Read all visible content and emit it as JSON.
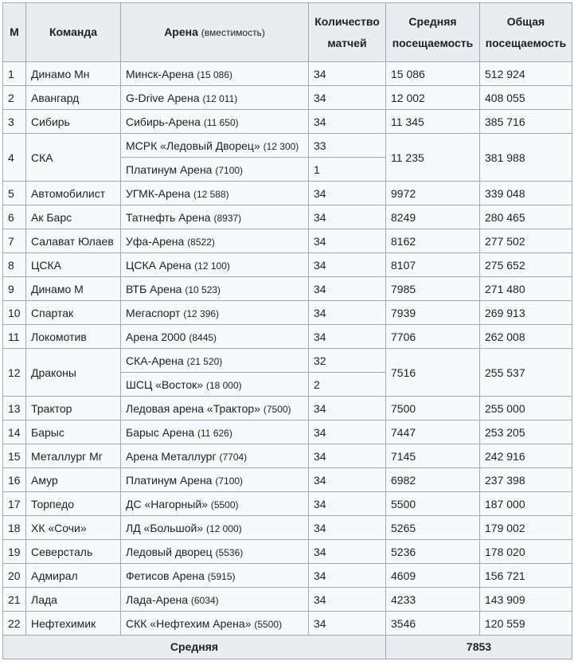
{
  "table": {
    "headers": {
      "m": "М",
      "team": "Команда",
      "arena": "Арена",
      "arena_note": "(вместимость)",
      "matches_l1": "Количество",
      "matches_l2": "матчей",
      "avg_l1": "Средняя",
      "avg_l2": "посещаемость",
      "total_l1": "Общая",
      "total_l2": "посещаемость"
    },
    "rows": [
      {
        "m": "1",
        "team": "Динамо Мн",
        "arenas": [
          {
            "name": "Минск-Арена",
            "cap": "(15 086)",
            "matches": "34"
          }
        ],
        "avg": "15 086",
        "total": "512 924"
      },
      {
        "m": "2",
        "team": "Авангард",
        "arenas": [
          {
            "name": "G-Drive Арена",
            "cap": "(12 011)",
            "matches": "34"
          }
        ],
        "avg": "12 002",
        "total": "408 055"
      },
      {
        "m": "3",
        "team": "Сибирь",
        "arenas": [
          {
            "name": "Сибирь-Арена",
            "cap": "(11 650)",
            "matches": "34"
          }
        ],
        "avg": "11 345",
        "total": "385 716"
      },
      {
        "m": "4",
        "team": "СКА",
        "arenas": [
          {
            "name": "МСРК «Ледовый Дворец»",
            "cap": "(12 300)",
            "matches": "33"
          },
          {
            "name": "Платинум Арена",
            "cap": "(7100)",
            "matches": "1"
          }
        ],
        "avg": "11 235",
        "total": "381 988"
      },
      {
        "m": "5",
        "team": "Автомобилист",
        "arenas": [
          {
            "name": "УГМК-Арена",
            "cap": "(12 588)",
            "matches": "34"
          }
        ],
        "avg": "9972",
        "total": "339 048"
      },
      {
        "m": "6",
        "team": "Ак Барс",
        "arenas": [
          {
            "name": "Татнефть Арена",
            "cap": "(8937)",
            "matches": "34"
          }
        ],
        "avg": "8249",
        "total": "280 465"
      },
      {
        "m": "7",
        "team": "Салават Юлаев",
        "arenas": [
          {
            "name": "Уфа-Арена",
            "cap": "(8522)",
            "matches": "34"
          }
        ],
        "avg": "8162",
        "total": "277 502"
      },
      {
        "m": "8",
        "team": "ЦСКА",
        "arenas": [
          {
            "name": "ЦСКА Арена",
            "cap": "(12 100)",
            "matches": "34"
          }
        ],
        "avg": "8107",
        "total": "275 652"
      },
      {
        "m": "9",
        "team": "Динамо М",
        "arenas": [
          {
            "name": "ВТБ Арена",
            "cap": "(10 523)",
            "matches": "34"
          }
        ],
        "avg": "7985",
        "total": "271 480"
      },
      {
        "m": "10",
        "team": "Спартак",
        "arenas": [
          {
            "name": "Мегаспорт",
            "cap": "(12 396)",
            "matches": "34"
          }
        ],
        "avg": "7939",
        "total": "269 913"
      },
      {
        "m": "11",
        "team": "Локомотив",
        "arenas": [
          {
            "name": "Арена 2000",
            "cap": "(8445)",
            "matches": "34"
          }
        ],
        "avg": "7706",
        "total": "262 008"
      },
      {
        "m": "12",
        "team": "Драконы",
        "arenas": [
          {
            "name": "СКА-Арена",
            "cap": "(21 520)",
            "matches": "32"
          },
          {
            "name": "ШСЦ «Восток»",
            "cap": "(18 000)",
            "matches": "2"
          }
        ],
        "avg": "7516",
        "total": "255 537"
      },
      {
        "m": "13",
        "team": "Трактор",
        "arenas": [
          {
            "name": "Ледовая арена «Трактор»",
            "cap": "(7500)",
            "matches": "34"
          }
        ],
        "avg": "7500",
        "total": "255 000"
      },
      {
        "m": "14",
        "team": "Барыс",
        "arenas": [
          {
            "name": "Барыс Арена",
            "cap": "(11 626)",
            "matches": "34"
          }
        ],
        "avg": "7447",
        "total": "253 205"
      },
      {
        "m": "15",
        "team": "Металлург Мг",
        "arenas": [
          {
            "name": "Арена Металлург",
            "cap": "(7704)",
            "matches": "34"
          }
        ],
        "avg": "7145",
        "total": "242 916"
      },
      {
        "m": "16",
        "team": "Амур",
        "arenas": [
          {
            "name": "Платинум Арена",
            "cap": "(7100)",
            "matches": "34"
          }
        ],
        "avg": "6982",
        "total": "237 398"
      },
      {
        "m": "17",
        "team": "Торпедо",
        "arenas": [
          {
            "name": "ДС «Нагорный»",
            "cap": "(5500)",
            "matches": "34"
          }
        ],
        "avg": "5500",
        "total": "187 000"
      },
      {
        "m": "18",
        "team": "ХК «Сочи»",
        "arenas": [
          {
            "name": "ЛД «Большой»",
            "cap": "(12 000)",
            "matches": "34"
          }
        ],
        "avg": "5265",
        "total": "179 002"
      },
      {
        "m": "19",
        "team": "Северсталь",
        "arenas": [
          {
            "name": "Ледовый дворец",
            "cap": "(5536)",
            "matches": "34"
          }
        ],
        "avg": "5236",
        "total": "178 020"
      },
      {
        "m": "20",
        "team": "Адмирал",
        "arenas": [
          {
            "name": "Фетисов Арена",
            "cap": "(5915)",
            "matches": "34"
          }
        ],
        "avg": "4609",
        "total": "156 721"
      },
      {
        "m": "21",
        "team": "Лада",
        "arenas": [
          {
            "name": "Лада-Арена",
            "cap": "(6034)",
            "matches": "34"
          }
        ],
        "avg": "4233",
        "total": "143 909"
      },
      {
        "m": "22",
        "team": "Нефтехимик",
        "arenas": [
          {
            "name": "СКК «Нефтехим Арена»",
            "cap": "(5500)",
            "matches": "34"
          }
        ],
        "avg": "3546",
        "total": "120 559"
      }
    ],
    "footer": {
      "label": "Средняя",
      "value": "7853"
    }
  }
}
